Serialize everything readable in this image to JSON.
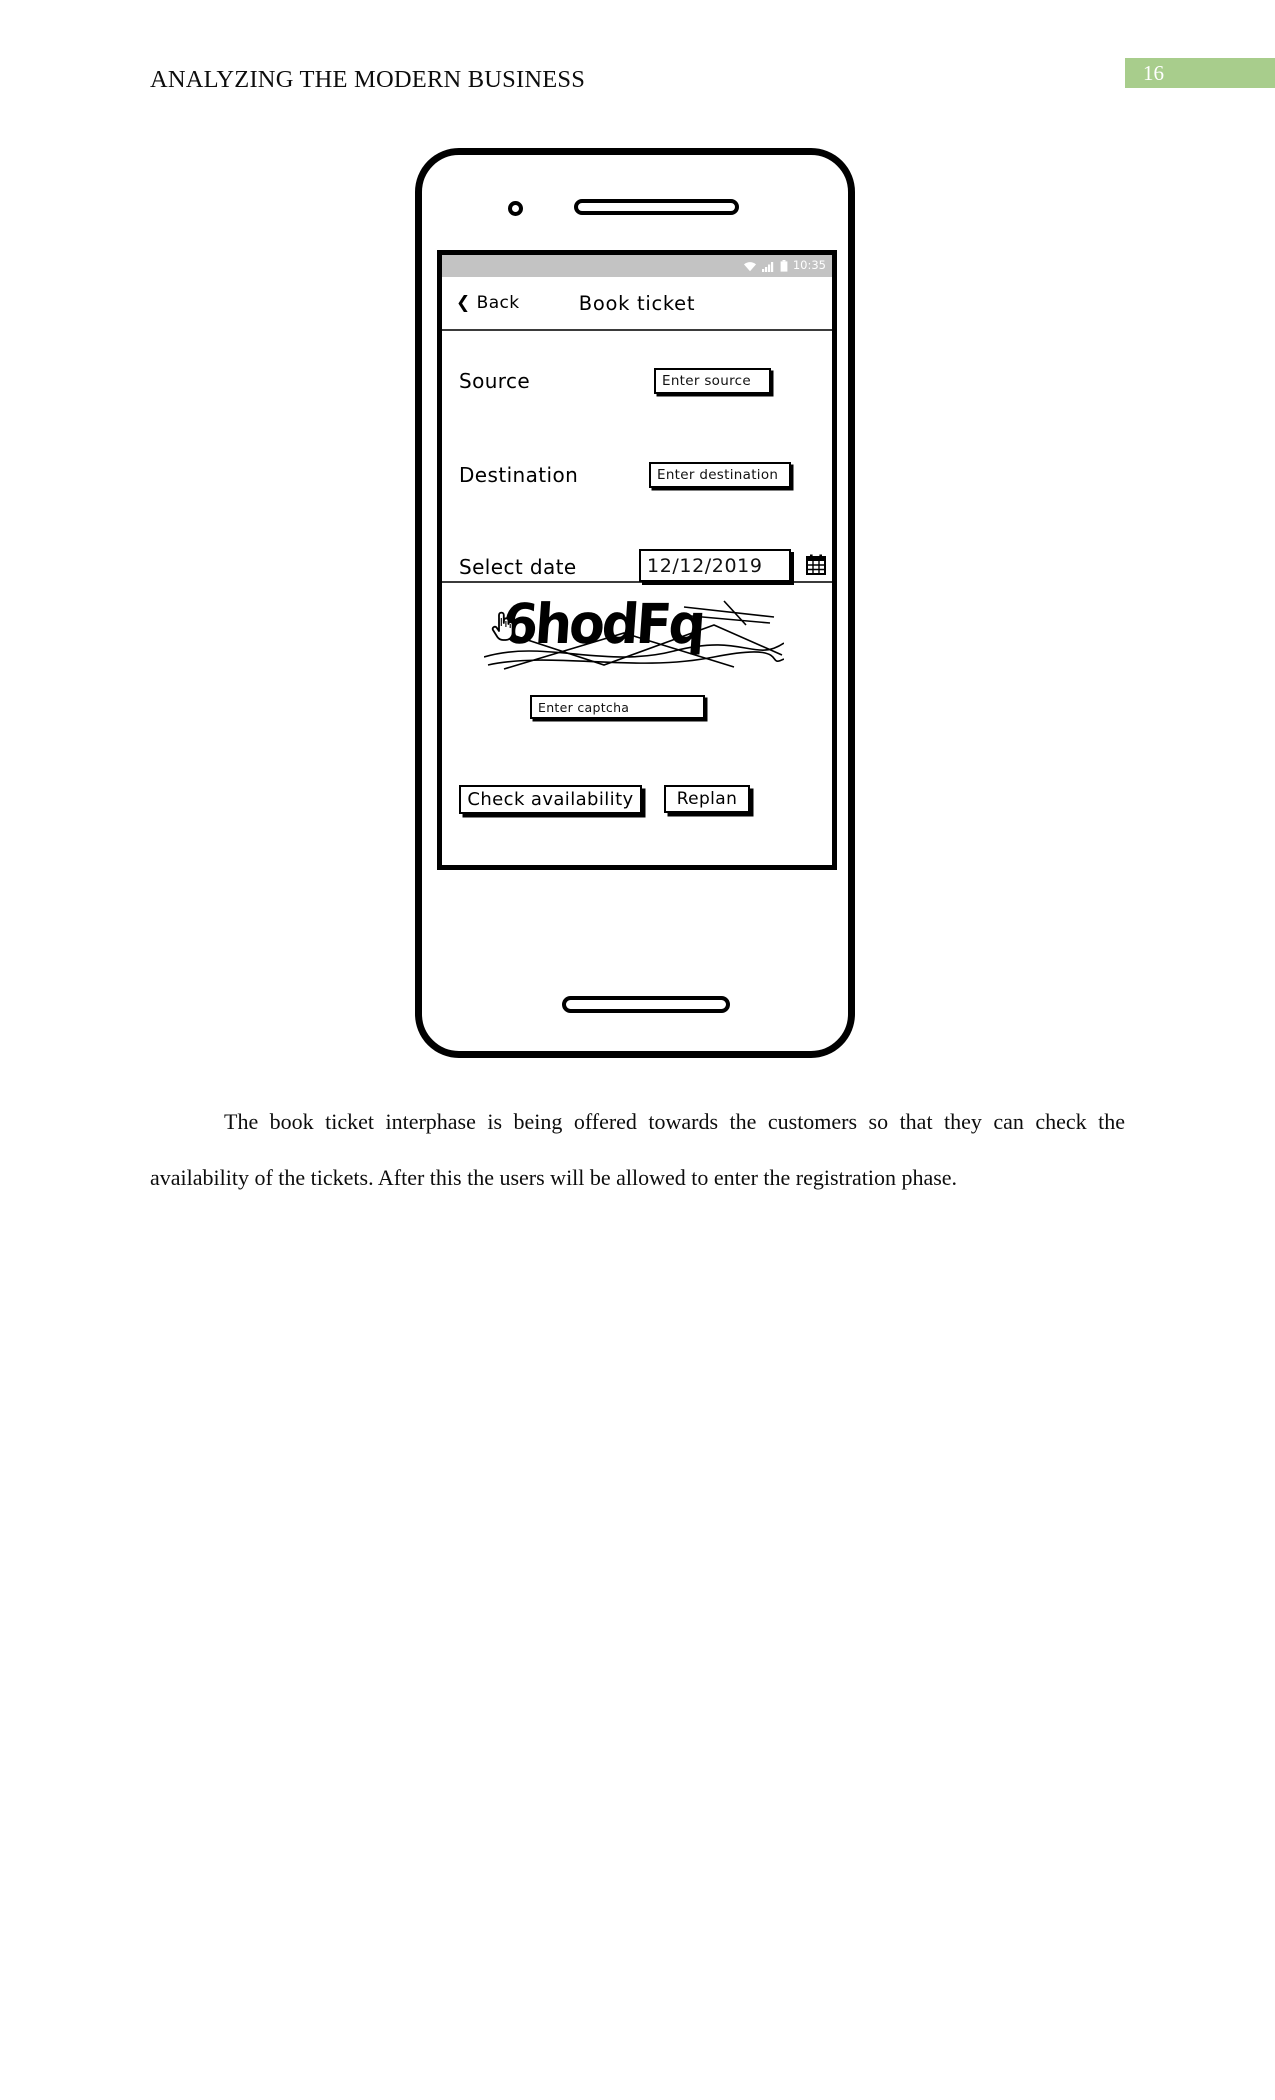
{
  "document": {
    "header_title": "ANALYZING THE MODERN BUSINESS",
    "page_number": "16",
    "badge_color": "#a8cd8c",
    "body_paragraph": "The book ticket interphase is being offered towards the customers so that they can check the availability of the tickets. After this the users will be allowed to enter the registration phase."
  },
  "phone": {
    "status_bar": {
      "time": "10:35",
      "icons": [
        "wifi-icon",
        "signal-icon",
        "battery-icon"
      ]
    },
    "nav": {
      "back_label": "Back",
      "back_icon": "chevron-left-icon",
      "title": "Book ticket"
    },
    "form": {
      "fields": [
        {
          "label": "Source",
          "placeholder": "Enter source",
          "value": ""
        },
        {
          "label": "Destination",
          "placeholder": "Enter destination",
          "value": ""
        },
        {
          "label": "Select date",
          "placeholder": "",
          "value": "12/12/2019",
          "trailing_icon": "calendar-icon"
        }
      ]
    },
    "captcha": {
      "challenge_text": "6hodFq",
      "cursor_icon": "hand-pointer-icon",
      "input_placeholder": "Enter captcha",
      "input_value": ""
    },
    "actions": {
      "primary_label": "Check availability",
      "secondary_label": "Replan"
    }
  }
}
